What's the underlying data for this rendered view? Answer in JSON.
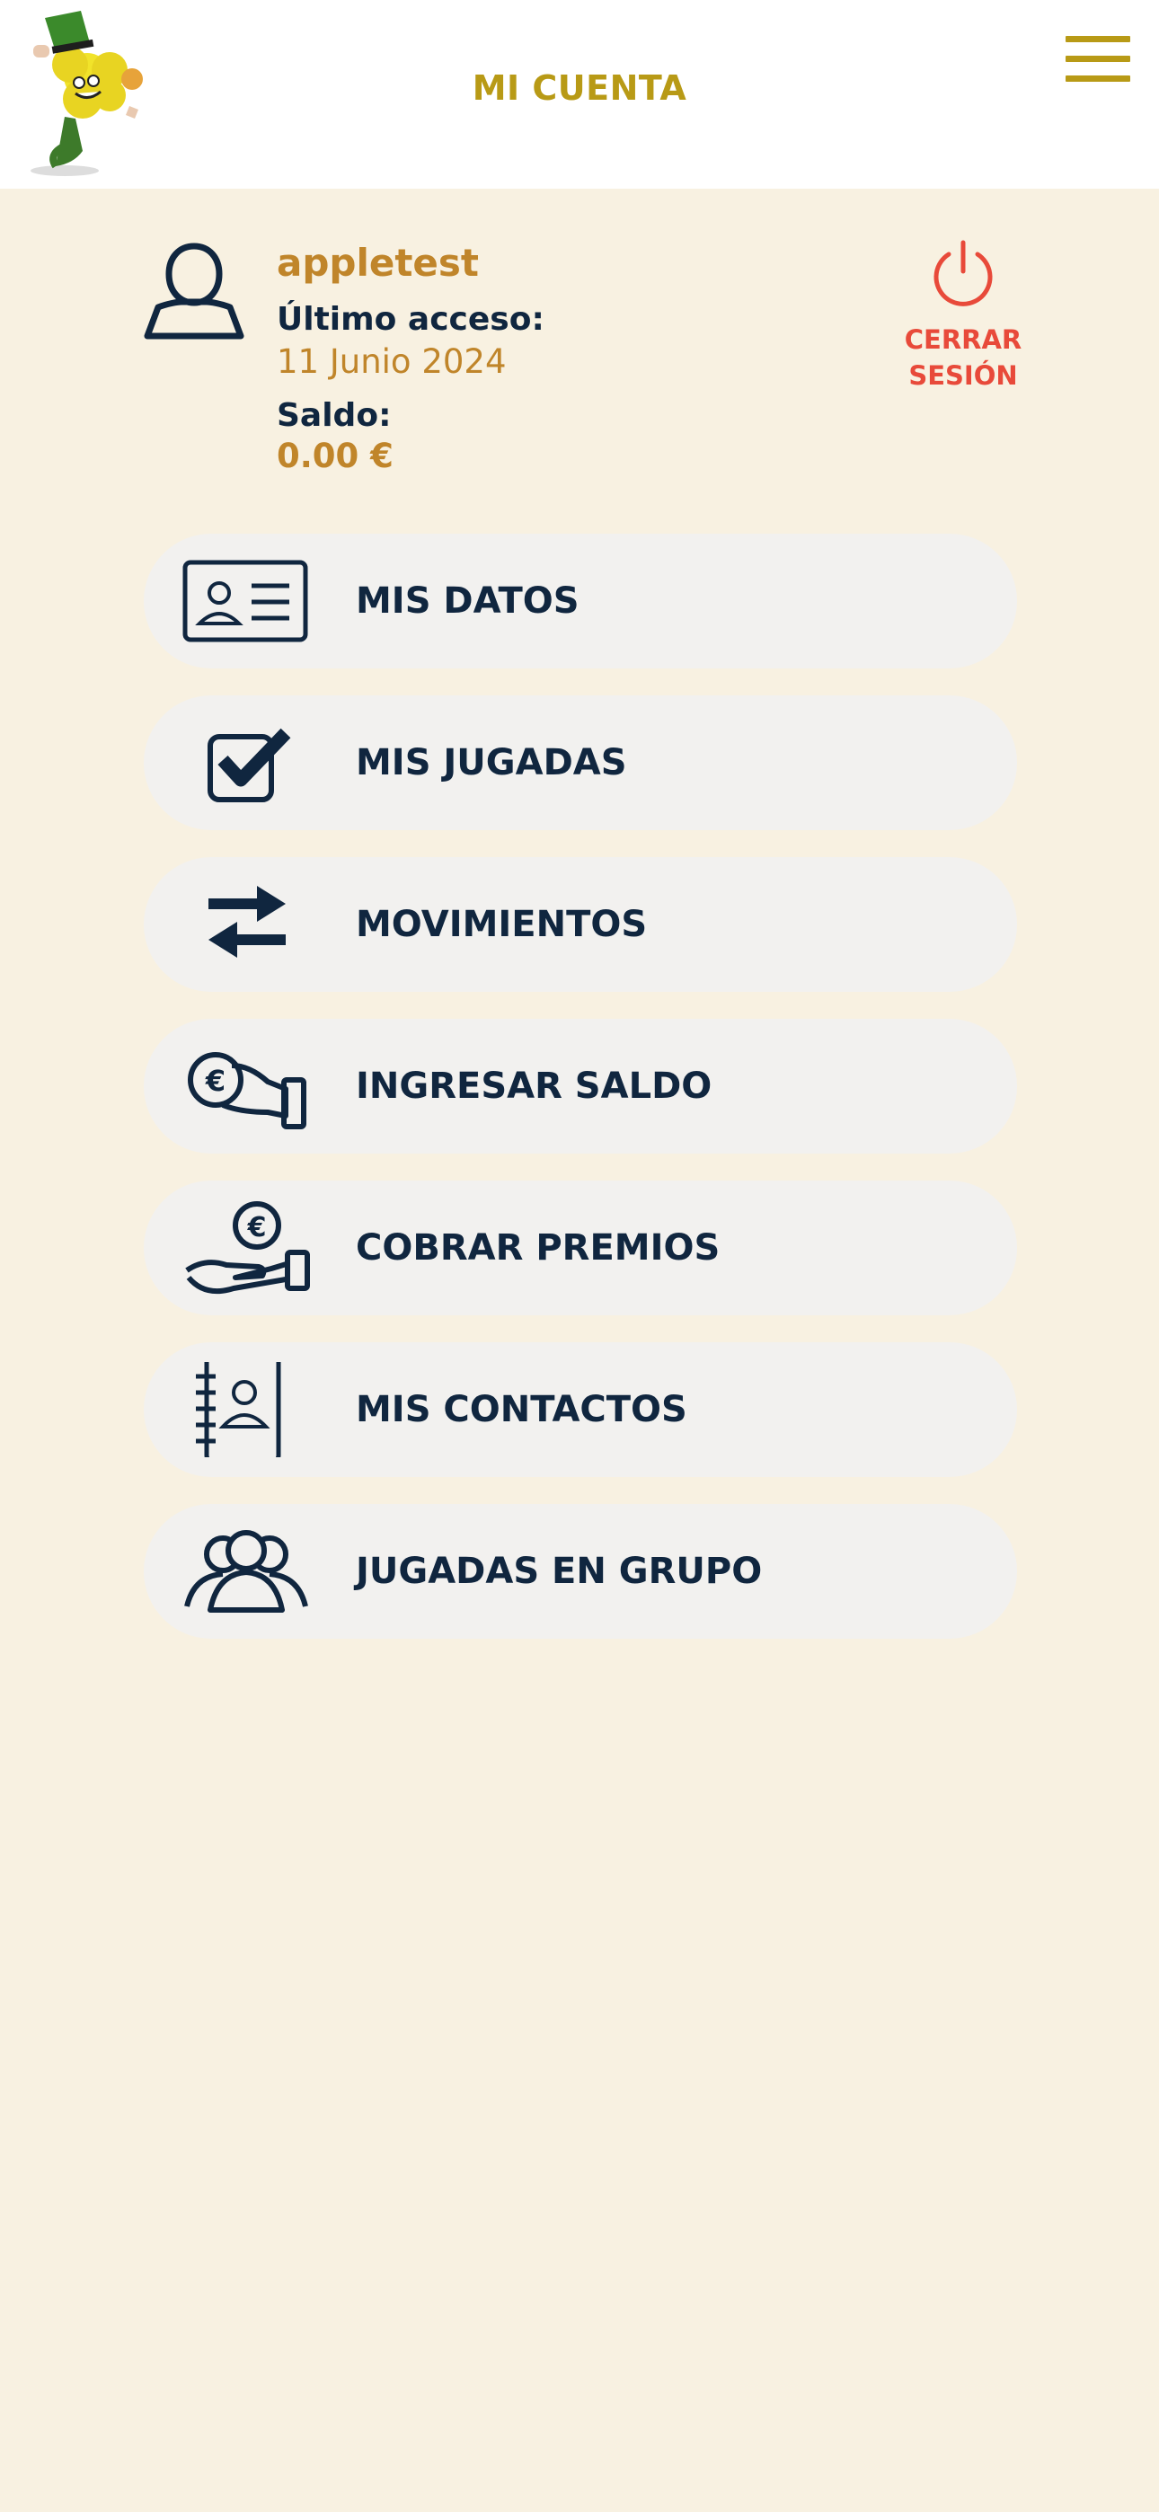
{
  "header": {
    "title": "MI CUENTA",
    "logo_icon": "shamrock-mascot-logo",
    "menu_icon": "hamburger-menu-icon"
  },
  "user": {
    "username": "appletest",
    "last_access_label": "Último acceso:",
    "last_access_value": "11 Junio 2024",
    "balance_label": "Saldo:",
    "balance_value": "0.00 €"
  },
  "logout": {
    "line1": "CERRAR",
    "line2": "SESIÓN",
    "icon": "power-icon"
  },
  "menu": [
    {
      "label": "MIS DATOS",
      "icon": "id-card-icon"
    },
    {
      "label": "MIS JUGADAS",
      "icon": "checkbox-check-icon"
    },
    {
      "label": "MOVIMIENTOS",
      "icon": "transfer-arrows-icon"
    },
    {
      "label": "INGRESAR SALDO",
      "icon": "deposit-coin-hand-icon"
    },
    {
      "label": "COBRAR PREMIOS",
      "icon": "collect-prize-hand-icon"
    },
    {
      "label": "MIS CONTACTOS",
      "icon": "address-book-icon"
    },
    {
      "label": "JUGADAS EN GRUPO",
      "icon": "group-users-icon"
    }
  ],
  "colors": {
    "accent_gold": "#b89a16",
    "text_gold": "#c0852a",
    "navy": "#10263f",
    "logout_red": "#e84a3a",
    "background": "#f8f1e1",
    "pill": "#f2f1ef"
  }
}
